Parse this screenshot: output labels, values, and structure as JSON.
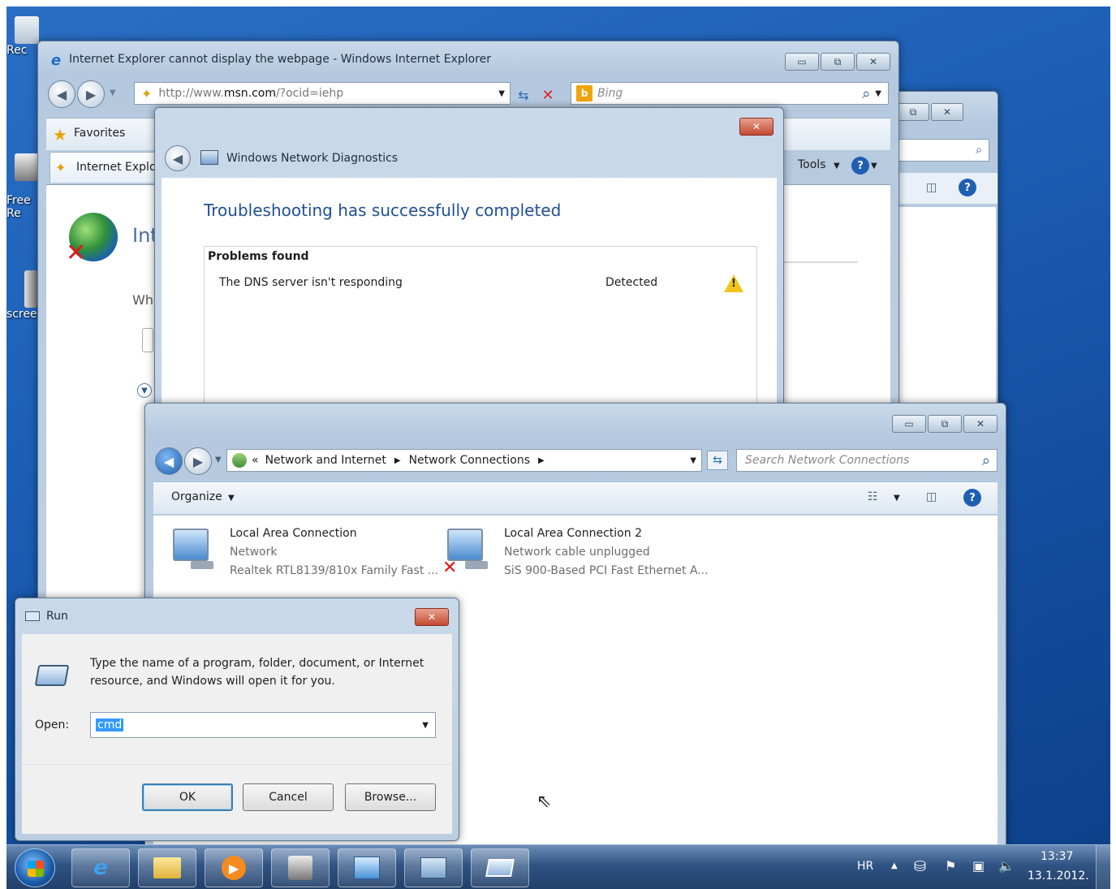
{
  "desktop": {
    "icons": [
      {
        "label": "Rec"
      },
      {
        "label": "Free\nRe"
      },
      {
        "label": "scree"
      }
    ]
  },
  "ie_back": {
    "restore_glyph": "⧉",
    "close_glyph": "✕"
  },
  "ie": {
    "title": "Internet Explorer cannot display the webpage - Windows Internet Explorer",
    "address": {
      "prefix": "http://www.",
      "domain": "msn.com",
      "suffix": "/?ocid=iehp"
    },
    "search_placeholder": "Bing",
    "favorites_label": "Favorites",
    "tab_label": "Internet Explo",
    "tools_label": "Tools",
    "page_heading_fragment": "Int",
    "page_text_fragment": "Wh",
    "minimize_glyph": "▭",
    "maximize_glyph": "⧉",
    "close_glyph": "✕"
  },
  "wnd": {
    "title": "Windows Network Diagnostics",
    "heading": "Troubleshooting has successfully completed",
    "problems_header": "Problems found",
    "problems": [
      {
        "name": "The DNS server isn't responding",
        "status": "Detected",
        "icon": "warning-icon"
      }
    ],
    "close_glyph": "✕"
  },
  "netconn": {
    "breadcrumb": [
      "Network and Internet",
      "Network Connections"
    ],
    "search_placeholder": "Search Network Connections",
    "organize_label": "Organize",
    "connections": [
      {
        "name": "Local Area Connection",
        "status": "Network",
        "adapter": "Realtek RTL8139/810x Family Fast ...",
        "disconnected": false
      },
      {
        "name": "Local Area Connection 2",
        "status": "Network cable unplugged",
        "adapter": "SiS 900-Based PCI Fast Ethernet A...",
        "disconnected": true
      }
    ],
    "minimize_glyph": "▭",
    "maximize_glyph": "⧉",
    "close_glyph": "✕"
  },
  "run": {
    "title": "Run",
    "description_line1": "Type the name of a program, folder, document, or Internet",
    "description_line2": "resource, and Windows will open it for you.",
    "open_label": "Open:",
    "open_value": "cmd",
    "ok_label": "OK",
    "cancel_label": "Cancel",
    "browse_label": "Browse...",
    "close_glyph": "✕"
  },
  "taskbar": {
    "language": "HR",
    "time": "13:37",
    "date": "13.1.2012."
  }
}
